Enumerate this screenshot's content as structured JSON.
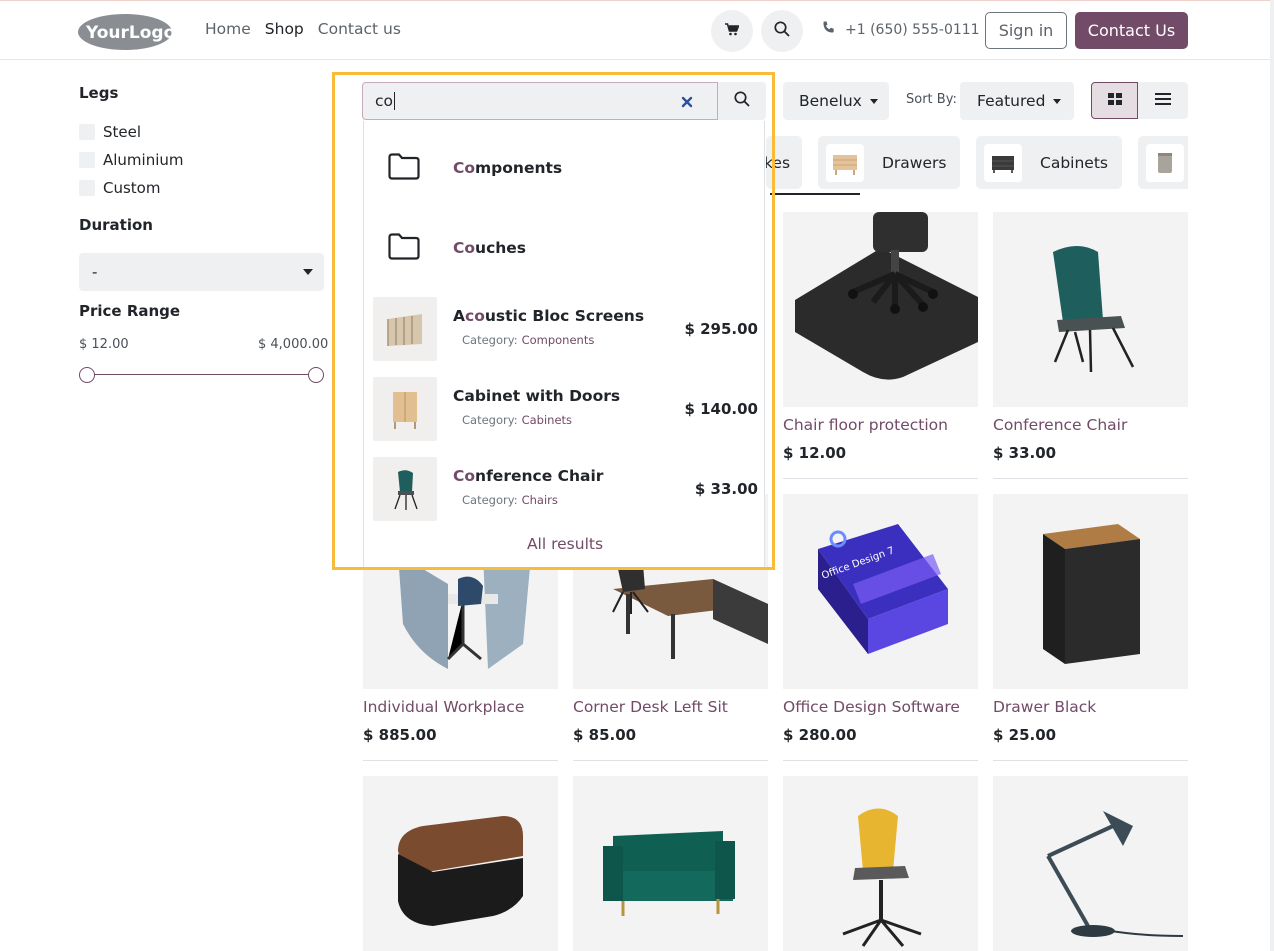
{
  "header": {
    "logo_text": "YourLogo",
    "nav": [
      {
        "label": "Home",
        "active": false
      },
      {
        "label": "Shop",
        "active": true
      },
      {
        "label": "Contact us",
        "active": false
      }
    ],
    "phone": "+1 (650) 555-0111",
    "sign_in_label": "Sign in",
    "contact_label": "Contact Us",
    "icons": [
      "cart-icon",
      "search-icon",
      "phone-icon"
    ]
  },
  "sidebar": {
    "legs_title": "Legs",
    "legs_options": [
      "Steel",
      "Aluminium",
      "Custom"
    ],
    "duration_title": "Duration",
    "duration_value": "-",
    "price_title": "Price Range",
    "price_min": "$ 12.00",
    "price_max": "$ 4,000.00",
    "price_range_values": [
      12,
      4000
    ]
  },
  "search": {
    "value": "co",
    "clear_icon": "close-icon",
    "button_icon": "search-icon",
    "dropdown": {
      "folders": [
        {
          "match": "Co",
          "rest": "mponents"
        },
        {
          "match": "Co",
          "rest": "uches"
        }
      ],
      "products": [
        {
          "pre": "A",
          "match": "co",
          "rest": "ustic Bloc Screens",
          "category_label": "Category:",
          "category": "Components",
          "price": "$ 295.00"
        },
        {
          "pre": "",
          "match": "",
          "rest": "Cabinet with Doors",
          "category_label": "Category:",
          "category": "Cabinets",
          "price": "$ 140.00"
        },
        {
          "pre": "",
          "match": "Co",
          "rest": "nference Chair",
          "category_label": "Category:",
          "category": "Chairs",
          "price": "$ 33.00"
        }
      ],
      "all_results_label": "All results"
    }
  },
  "toolbar": {
    "pricelist": "Benelux",
    "sort_by_label": "Sort By:",
    "sort_value": "Featured",
    "view_active": "grid"
  },
  "categories": [
    {
      "label": "kes",
      "partial": true
    },
    {
      "label": "Drawers"
    },
    {
      "label": "Cabinets"
    },
    {
      "label": "",
      "partial": true
    }
  ],
  "products": [
    {
      "name": "Chair floor protection",
      "price": "$ 12.00"
    },
    {
      "name": "Conference Chair",
      "price": "$ 33.00"
    },
    {
      "name": "Individual Workplace",
      "price": "$ 885.00"
    },
    {
      "name": "Corner Desk Left Sit",
      "price": "$ 85.00"
    },
    {
      "name": "Office Design Software",
      "price": "$ 280.00"
    },
    {
      "name": "Drawer Black",
      "price": "$ 25.00"
    }
  ],
  "software_box_text": "Office Design 7",
  "colors": {
    "brand": "#714b67",
    "highlight_frame": "#f8bc3a",
    "pill_bg": "#eef0f2"
  }
}
